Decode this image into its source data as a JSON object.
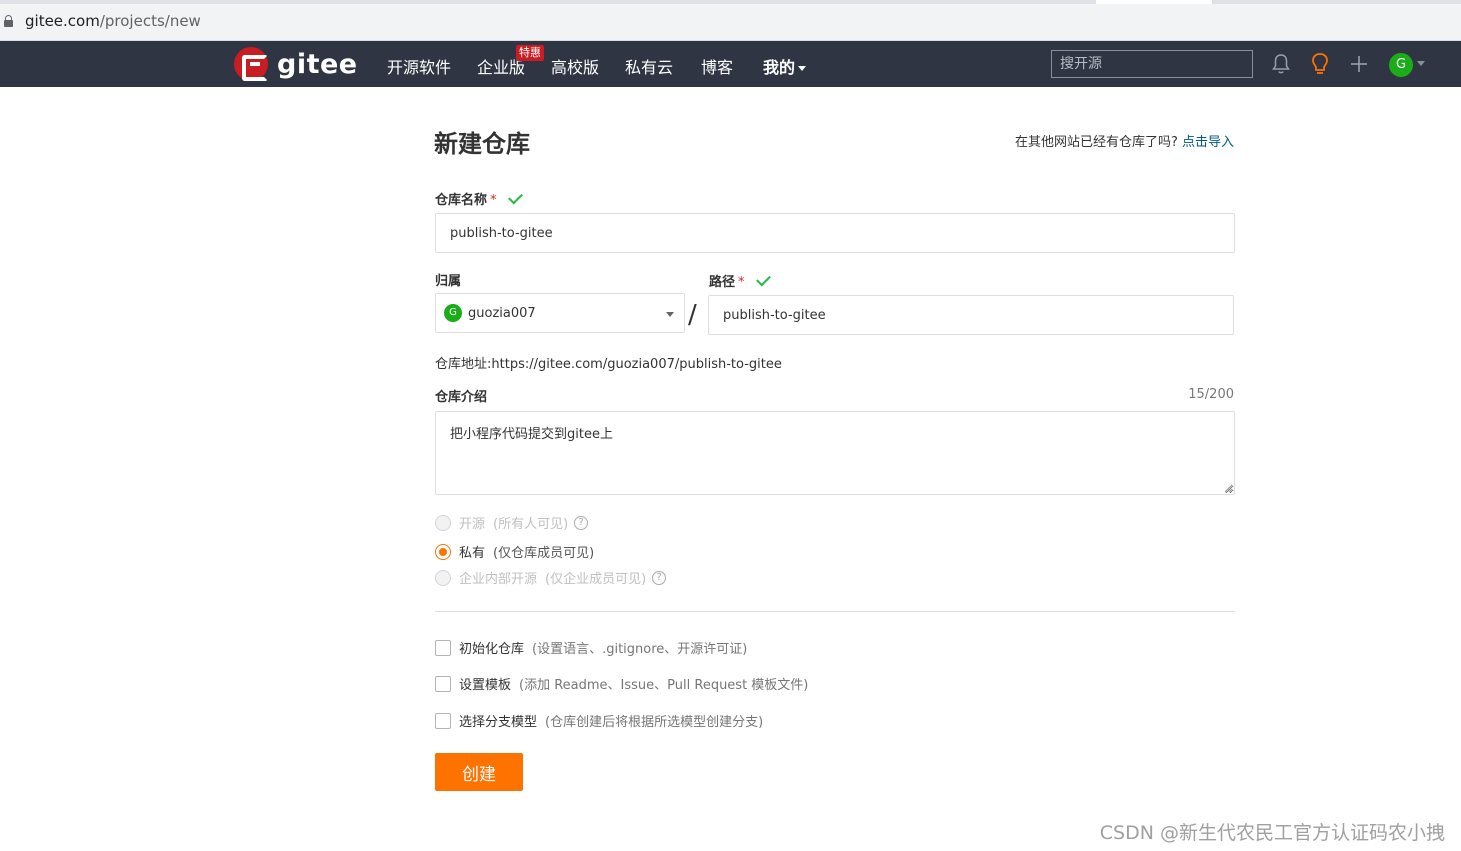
{
  "browser": {
    "url_host": "gitee.com",
    "url_path": "/projects/new"
  },
  "navbar": {
    "logo_text": "gitee",
    "items": [
      "开源软件",
      "企业版",
      "高校版",
      "私有云",
      "博客",
      "我的"
    ],
    "badge": "特惠",
    "search_placeholder": "搜开源",
    "avatar_letter": "G"
  },
  "form": {
    "title": "新建仓库",
    "import_prefix": "在其他网站已经有仓库了吗?",
    "import_link": "点击导入",
    "repo_name_label": "仓库名称",
    "required_mark": "*",
    "repo_name_value": "publish-to-gitee",
    "owner_label": "归属",
    "owner_avatar": "G",
    "owner_value": "guozia007",
    "slash": "/",
    "path_label": "路径",
    "path_value": "publish-to-gitee",
    "repo_url": "仓库地址:https://gitee.com/guozia007/publish-to-gitee",
    "desc_label": "仓库介绍",
    "desc_counter": "15/200",
    "desc_value": "把小程序代码提交到gitee上",
    "visibility": [
      {
        "label": "开源",
        "note": "(所有人可见)",
        "selected": false,
        "disabled": true,
        "help": true
      },
      {
        "label": "私有",
        "note": "(仅仓库成员可见)",
        "selected": true,
        "disabled": false,
        "help": false
      },
      {
        "label": "企业内部开源",
        "note": "(仅企业成员可见)",
        "selected": false,
        "disabled": true,
        "help": true
      }
    ],
    "options": [
      {
        "label": "初始化仓库",
        "note": "(设置语言、.gitignore、开源许可证)",
        "checked": false
      },
      {
        "label": "设置模板",
        "note": "(添加 Readme、Issue、Pull Request 模板文件)",
        "checked": false
      },
      {
        "label": "选择分支模型",
        "note": "(仓库创建后将根据所选模型创建分支)",
        "checked": false
      }
    ],
    "create_label": "创建"
  },
  "watermark": "CSDN @新生代农民工官方认证码农小拽",
  "colors": {
    "navbar": "#2f3542",
    "brand_red": "#c71d23",
    "accent_orange": "#fe7300",
    "success_green": "#21ba45",
    "link": "#005980"
  }
}
